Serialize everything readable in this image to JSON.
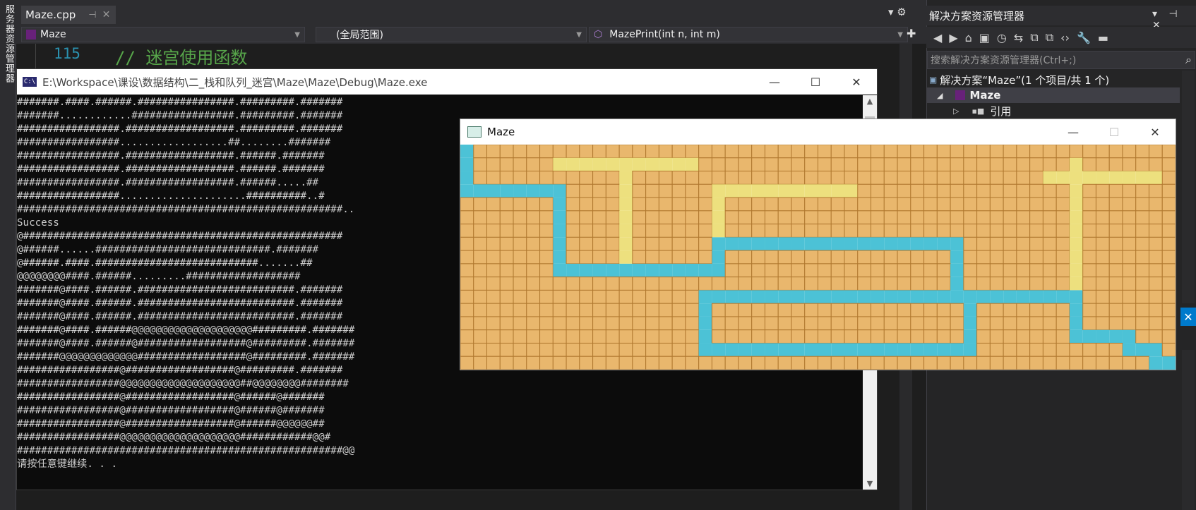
{
  "ide": {
    "side_strip_label": "服务器资源管理器",
    "file_tab": {
      "name": "Maze.cpp",
      "pin": "⊣",
      "close": "✕"
    },
    "tab_tools": "▾  ⚙",
    "nav": {
      "project": "Maze",
      "scope": "(全局范围)",
      "member": "MazePrint(int n, int m)"
    },
    "code": {
      "line_number": "115",
      "comment": "// 迷宫使用函数"
    }
  },
  "solution_explorer": {
    "title": "解决方案资源管理器",
    "title_tools": "▾ ⊣ ✕",
    "toolbar_icons": [
      "back-icon",
      "forward-icon",
      "home-icon",
      "vs-icon",
      "history-icon",
      "sync-icon",
      "collapse-icon",
      "copy-icon",
      "code-icon",
      "wrench-icon",
      "preview-icon"
    ],
    "toolbar_glyphs": [
      "◀",
      "▶",
      "⌂",
      "▣",
      "◷",
      "⇆",
      "⧉",
      "⧉",
      "‹›",
      "🔧",
      "▬"
    ],
    "search_placeholder": "搜索解决方案资源管理器(Ctrl+;)",
    "tree": {
      "solution": "解决方案“Maze”(1 个项目/共 1 个)",
      "project": "Maze",
      "references": "引用"
    }
  },
  "console": {
    "title": "E:\\Workspace\\课设\\数据结构\\二_栈和队列_迷宫\\Maze\\Maze\\Debug\\Maze.exe",
    "lines": [
      "#######.####.######.################.#########.#######",
      "#######............#################.#########.#######",
      "#################.##################.#########.#######",
      "#################..................##........#######",
      "#################.##################.######.#######",
      "#################.##################.######.#######",
      "#################.##################.######.....##",
      "#################.....................##########..#",
      "######################################################..",
      "Success",
      "@#####################################################",
      "@######......#############################.#######",
      "@######.####.###########################.......##",
      "@@@@@@@@####.######.........###################",
      "#######@####.######.##########################.#######",
      "#######@####.######.##########################.#######",
      "#######@####.######.##########################.#######",
      "#######@####.######@@@@@@@@@@@@@@@@@@@@#########.#######",
      "#######@####.######@##################@#########.#######",
      "#######@@@@@@@@@@@@@##################@#########.#######",
      "#################@##################@#########.#######",
      "#################@@@@@@@@@@@@@@@@@@@@##@@@@@@@@########",
      "#################@##################@######@#######",
      "#################@##################@######@#######",
      "#################@##################@######@@@@@@##",
      "#################@@@@@@@@@@@@@@@@@@@@############@@#",
      "######################################################@@",
      "请按任意键继续. . ."
    ]
  },
  "maze_window": {
    "title": "Maze",
    "cols": 54,
    "rows": 17,
    "colors": {
      "wall": "#e9b76d",
      "wall_edge": "#b0782f",
      "explored": "#ede07e",
      "path": "#4cc2d6"
    },
    "explored_cells": [
      [
        1,
        7
      ],
      [
        1,
        8
      ],
      [
        1,
        9
      ],
      [
        1,
        10
      ],
      [
        1,
        11
      ],
      [
        1,
        12
      ],
      [
        1,
        13
      ],
      [
        1,
        14
      ],
      [
        1,
        15
      ],
      [
        1,
        16
      ],
      [
        1,
        17
      ],
      [
        2,
        12
      ],
      [
        3,
        12
      ],
      [
        4,
        12
      ],
      [
        5,
        12
      ],
      [
        6,
        12
      ],
      [
        7,
        12
      ],
      [
        8,
        12
      ],
      [
        9,
        12
      ],
      [
        3,
        19
      ],
      [
        3,
        20
      ],
      [
        3,
        21
      ],
      [
        3,
        22
      ],
      [
        3,
        23
      ],
      [
        3,
        24
      ],
      [
        3,
        25
      ],
      [
        3,
        26
      ],
      [
        3,
        27
      ],
      [
        3,
        28
      ],
      [
        3,
        29
      ],
      [
        4,
        19
      ],
      [
        5,
        19
      ],
      [
        6,
        19
      ],
      [
        7,
        19
      ],
      [
        1,
        46
      ],
      [
        2,
        44
      ],
      [
        2,
        45
      ],
      [
        2,
        46
      ],
      [
        2,
        47
      ],
      [
        2,
        48
      ],
      [
        2,
        49
      ],
      [
        2,
        50
      ],
      [
        2,
        51
      ],
      [
        2,
        52
      ],
      [
        3,
        46
      ],
      [
        4,
        46
      ],
      [
        5,
        46
      ],
      [
        6,
        46
      ],
      [
        7,
        46
      ],
      [
        8,
        46
      ],
      [
        9,
        46
      ],
      [
        10,
        46
      ],
      [
        11,
        46
      ]
    ],
    "path_cells": [
      [
        0,
        0
      ],
      [
        1,
        0
      ],
      [
        2,
        0
      ],
      [
        3,
        0
      ],
      [
        3,
        1
      ],
      [
        3,
        2
      ],
      [
        3,
        3
      ],
      [
        3,
        4
      ],
      [
        3,
        5
      ],
      [
        3,
        6
      ],
      [
        3,
        7
      ],
      [
        4,
        7
      ],
      [
        5,
        7
      ],
      [
        6,
        7
      ],
      [
        7,
        7
      ],
      [
        8,
        7
      ],
      [
        9,
        7
      ],
      [
        9,
        8
      ],
      [
        9,
        9
      ],
      [
        9,
        10
      ],
      [
        9,
        11
      ],
      [
        9,
        12
      ],
      [
        9,
        13
      ],
      [
        9,
        14
      ],
      [
        9,
        15
      ],
      [
        9,
        16
      ],
      [
        9,
        17
      ],
      [
        9,
        18
      ],
      [
        9,
        19
      ],
      [
        8,
        19
      ],
      [
        7,
        19
      ],
      [
        7,
        20
      ],
      [
        7,
        21
      ],
      [
        7,
        22
      ],
      [
        7,
        23
      ],
      [
        7,
        24
      ],
      [
        7,
        25
      ],
      [
        7,
        26
      ],
      [
        7,
        27
      ],
      [
        7,
        28
      ],
      [
        7,
        29
      ],
      [
        7,
        30
      ],
      [
        7,
        31
      ],
      [
        7,
        32
      ],
      [
        7,
        33
      ],
      [
        7,
        34
      ],
      [
        7,
        35
      ],
      [
        7,
        36
      ],
      [
        7,
        37
      ],
      [
        8,
        37
      ],
      [
        9,
        37
      ],
      [
        10,
        37
      ],
      [
        11,
        37
      ],
      [
        11,
        36
      ],
      [
        11,
        35
      ],
      [
        11,
        34
      ],
      [
        11,
        33
      ],
      [
        11,
        32
      ],
      [
        11,
        31
      ],
      [
        11,
        30
      ],
      [
        11,
        29
      ],
      [
        11,
        28
      ],
      [
        11,
        27
      ],
      [
        11,
        26
      ],
      [
        11,
        25
      ],
      [
        11,
        24
      ],
      [
        11,
        23
      ],
      [
        11,
        22
      ],
      [
        11,
        21
      ],
      [
        11,
        20
      ],
      [
        11,
        19
      ],
      [
        11,
        18
      ],
      [
        12,
        18
      ],
      [
        13,
        18
      ],
      [
        14,
        18
      ],
      [
        15,
        18
      ],
      [
        15,
        19
      ],
      [
        15,
        20
      ],
      [
        15,
        21
      ],
      [
        15,
        22
      ],
      [
        15,
        23
      ],
      [
        15,
        24
      ],
      [
        15,
        25
      ],
      [
        15,
        26
      ],
      [
        15,
        27
      ],
      [
        15,
        28
      ],
      [
        15,
        29
      ],
      [
        15,
        30
      ],
      [
        15,
        31
      ],
      [
        15,
        32
      ],
      [
        15,
        33
      ],
      [
        15,
        34
      ],
      [
        15,
        35
      ],
      [
        15,
        36
      ],
      [
        15,
        37
      ],
      [
        15,
        38
      ],
      [
        14,
        38
      ],
      [
        13,
        38
      ],
      [
        12,
        38
      ],
      [
        11,
        38
      ],
      [
        11,
        39
      ],
      [
        11,
        40
      ],
      [
        11,
        41
      ],
      [
        11,
        42
      ],
      [
        11,
        43
      ],
      [
        11,
        44
      ],
      [
        11,
        45
      ],
      [
        11,
        46
      ],
      [
        12,
        46
      ],
      [
        13,
        46
      ],
      [
        14,
        46
      ],
      [
        14,
        47
      ],
      [
        14,
        48
      ],
      [
        14,
        49
      ],
      [
        14,
        50
      ],
      [
        15,
        50
      ],
      [
        15,
        51
      ],
      [
        15,
        52
      ],
      [
        16,
        52
      ],
      [
        16,
        53
      ]
    ]
  }
}
